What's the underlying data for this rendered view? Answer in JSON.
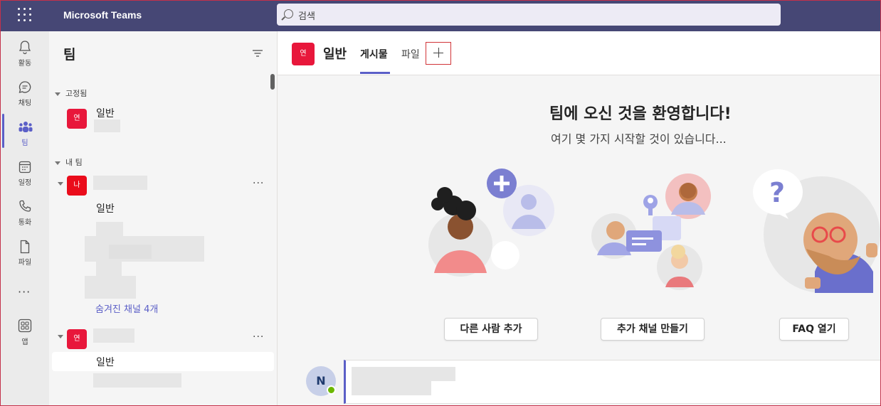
{
  "app": {
    "title": "Microsoft Teams"
  },
  "search": {
    "placeholder": "검색"
  },
  "rail": {
    "items": [
      {
        "label": "활동",
        "icon": "bell-icon"
      },
      {
        "label": "채팅",
        "icon": "chat-icon"
      },
      {
        "label": "팀",
        "icon": "teams-icon"
      },
      {
        "label": "일정",
        "icon": "calendar-icon"
      },
      {
        "label": "통화",
        "icon": "phone-icon"
      },
      {
        "label": "파일",
        "icon": "file-icon"
      },
      {
        "label": "앱",
        "icon": "apps-icon"
      }
    ],
    "more_label": "···"
  },
  "teams_pane": {
    "title": "팀",
    "pinned_header": "고정됨",
    "pinned_channel": "일반",
    "my_teams_header": "내 팀",
    "team1_avatar": "나",
    "team1_channel": "일반",
    "hidden_channels": "숨겨진 채널 4개",
    "team2_avatar": "연",
    "team2_channel": "일반",
    "pinned_avatar": "연",
    "more_label": "···"
  },
  "channel": {
    "avatar": "연",
    "name": "일반",
    "tabs": [
      "게시물",
      "파일"
    ]
  },
  "welcome": {
    "title": "팀에 오신 것을 환영합니다!",
    "subtitle": "여기 몇 가지 시작할 것이 있습니다...",
    "buttons": [
      "다른 사람 추가",
      "추가 채널 만들기",
      "FAQ 열기"
    ]
  },
  "post": {
    "author_initial": "N"
  },
  "colors": {
    "brand": "#464775",
    "accent": "#5b5fc7",
    "team_avatar": "#e8173b"
  }
}
